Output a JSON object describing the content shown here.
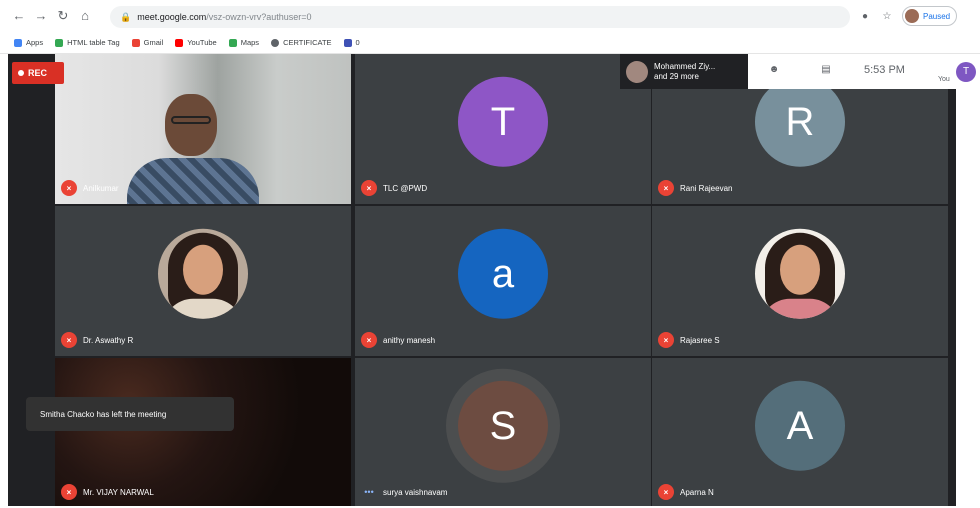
{
  "browser": {
    "url_host": "meet.google.com",
    "url_path": "/vsz-owzn-vrv?authuser=0",
    "profile_label": "Paused",
    "bookmarks": [
      {
        "label": "Apps",
        "color": "#4285f4"
      },
      {
        "label": "HTML table Tag",
        "color": "#34a853"
      },
      {
        "label": "Gmail",
        "color": "#ea4335"
      },
      {
        "label": "YouTube",
        "color": "#ff0000"
      },
      {
        "label": "Maps",
        "color": "#34a853"
      },
      {
        "label": "CERTIFICATE",
        "color": "#5f6368"
      },
      {
        "label": "0",
        "color": "#3f51b5"
      }
    ]
  },
  "meet": {
    "rec_label": "REC",
    "participants_summary_line1": "Mohammed Ziy...",
    "participants_summary_line2": "and 29 more",
    "time": "5:53 PM",
    "you_label": "You",
    "you_initial": "T",
    "toast": "Smitha Chacko has left the meeting",
    "tiles": [
      {
        "name": "Anilkumar",
        "mic": "off",
        "type": "camera"
      },
      {
        "name": "TLC @PWD",
        "mic": "off",
        "type": "initial",
        "initial": "T",
        "color": "#8e56c6"
      },
      {
        "name": "Rani Rajeevan",
        "mic": "off",
        "type": "initial",
        "initial": "R",
        "color": "#78909c"
      },
      {
        "name": "Dr. Aswathy R",
        "mic": "off",
        "type": "photo",
        "shirt_color": "#e3d8c8"
      },
      {
        "name": "anithy manesh",
        "mic": "off",
        "type": "initial",
        "initial": "a",
        "color": "#1565c0"
      },
      {
        "name": "Rajasree S",
        "mic": "off",
        "type": "photo",
        "shirt_color": "#d9828a"
      },
      {
        "name": "Mr. VIJAY NARWAL",
        "mic": "off",
        "type": "dark"
      },
      {
        "name": "surya vaishnavam",
        "mic": "on",
        "type": "initial",
        "initial": "S",
        "color": "#6d4c41"
      },
      {
        "name": "Aparna N",
        "mic": "off",
        "type": "initial",
        "initial": "A",
        "color": "#546e7a"
      }
    ]
  }
}
